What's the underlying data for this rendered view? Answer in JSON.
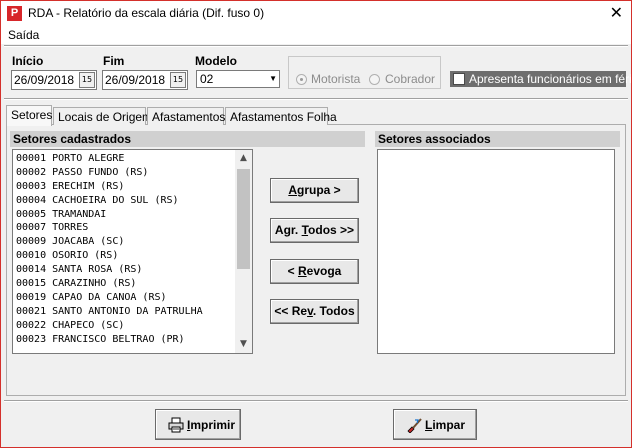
{
  "window": {
    "title": "RDA - Relatório da escala diária (Dif. fuso 0)",
    "close_glyph": "✕",
    "app_icon": "P"
  },
  "menu": {
    "items": [
      "Saída"
    ]
  },
  "filters": {
    "inicio_label": "Início",
    "inicio_value": "26/09/2018",
    "fim_label": "Fim",
    "fim_value": "26/09/2018",
    "calendar_glyph": "15",
    "modelo_label": "Modelo",
    "modelo_value": "02",
    "radio_motorista": "Motorista",
    "radio_cobrador": "Cobrador",
    "ferias_label": "Apresenta funcionários em férias"
  },
  "tabs": [
    "Setores",
    "Locais de Origem",
    "Afastamentos",
    "Afastamentos Folha"
  ],
  "panel": {
    "left_header": "Setores cadastrados",
    "right_header": "Setores associados",
    "setores": [
      "00001 PORTO ALEGRE",
      "00002 PASSO FUNDO (RS)",
      "00003 ERECHIM (RS)",
      "00004 CACHOEIRA DO SUL (RS)",
      "00005 TRAMANDAI",
      "00007 TORRES",
      "00009 JOACABA (SC)",
      "00010 OSORIO (RS)",
      "00014 SANTA ROSA (RS)",
      "00015 CARAZINHO (RS)",
      "00019 CAPAO DA CANOA (RS)",
      "00021 SANTO ANTONIO DA PATRULHA",
      "00022 CHAPECO (SC)",
      "00023 FRANCISCO BELTRAO (PR)"
    ],
    "associados": []
  },
  "actions": {
    "agrupa_pre": "",
    "agrupa_u": "A",
    "agrupa_post": "grupa >",
    "agr_todos_pre": "Agr. ",
    "agr_todos_u": "T",
    "agr_todos_post": "odos >>",
    "revoga_pre": "< ",
    "revoga_u": "R",
    "revoga_post": "evoga",
    "rev_todos_pre": "<< Re",
    "rev_todos_u": "v",
    "rev_todos_post": ". Todos"
  },
  "footer": {
    "imprimir_u": "I",
    "imprimir_post": "mprimir",
    "limpar_u": "L",
    "limpar_post": "impar"
  },
  "colors": {
    "accent": "#d7262a",
    "border": "#d4302b"
  }
}
